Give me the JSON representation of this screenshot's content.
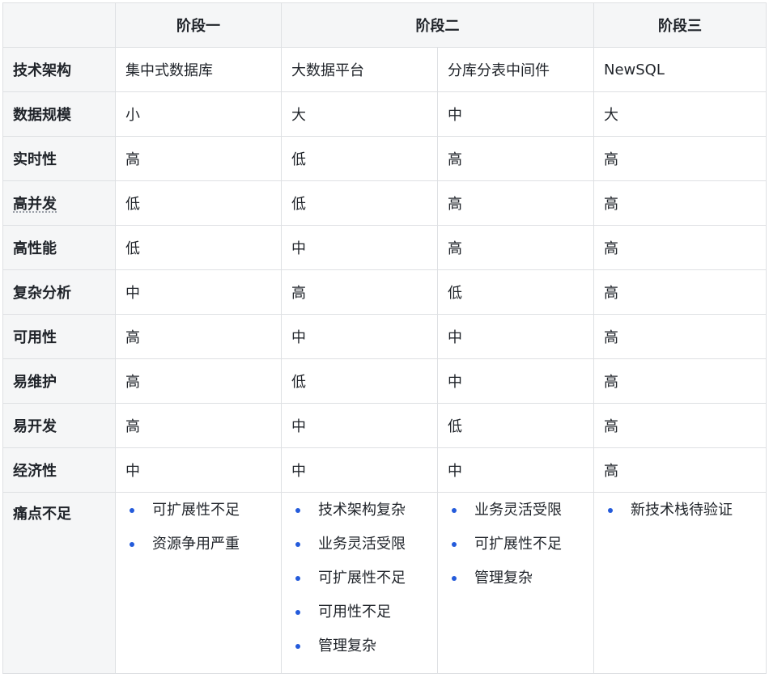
{
  "header": {
    "stage1": "阶段一",
    "stage2": "阶段二",
    "stage3": "阶段三"
  },
  "rows": [
    {
      "label": "技术架构",
      "s1": "集中式数据库",
      "s2a": "大数据平台",
      "s2b": "分库分表中间件",
      "s3": "NewSQL"
    },
    {
      "label": "数据规模",
      "s1": "小",
      "s2a": "大",
      "s2b": "中",
      "s3": "大"
    },
    {
      "label": "实时性",
      "s1": "高",
      "s2a": "低",
      "s2b": "高",
      "s3": "高"
    },
    {
      "label": "高并发",
      "s1": "低",
      "s2a": "低",
      "s2b": "高",
      "s3": "高"
    },
    {
      "label": "高性能",
      "s1": "低",
      "s2a": "中",
      "s2b": "高",
      "s3": "高"
    },
    {
      "label": "复杂分析",
      "s1": "中",
      "s2a": "高",
      "s2b": "低",
      "s3": "高"
    },
    {
      "label": "可用性",
      "s1": "高",
      "s2a": "中",
      "s2b": "中",
      "s3": "高"
    },
    {
      "label": "易维护",
      "s1": "高",
      "s2a": "低",
      "s2b": "中",
      "s3": "高"
    },
    {
      "label": "易开发",
      "s1": "高",
      "s2a": "中",
      "s2b": "低",
      "s3": "高"
    },
    {
      "label": "经济性",
      "s1": "中",
      "s2a": "中",
      "s2b": "中",
      "s3": "高"
    }
  ],
  "pain": {
    "label": "痛点不足",
    "s1": [
      "可扩展性不足",
      "资源争用严重"
    ],
    "s2a": [
      "技术架构复杂",
      "业务灵活受限",
      "可扩展性不足",
      "可用性不足",
      "管理复杂"
    ],
    "s2b": [
      "业务灵活受限",
      "可扩展性不足",
      "管理复杂"
    ],
    "s3": [
      "新技术栈待验证"
    ]
  },
  "colors": {
    "header_bg": "#f5f6f7",
    "border": "#dee0e3",
    "bullet": "#245bdb",
    "text": "#1f2329"
  }
}
